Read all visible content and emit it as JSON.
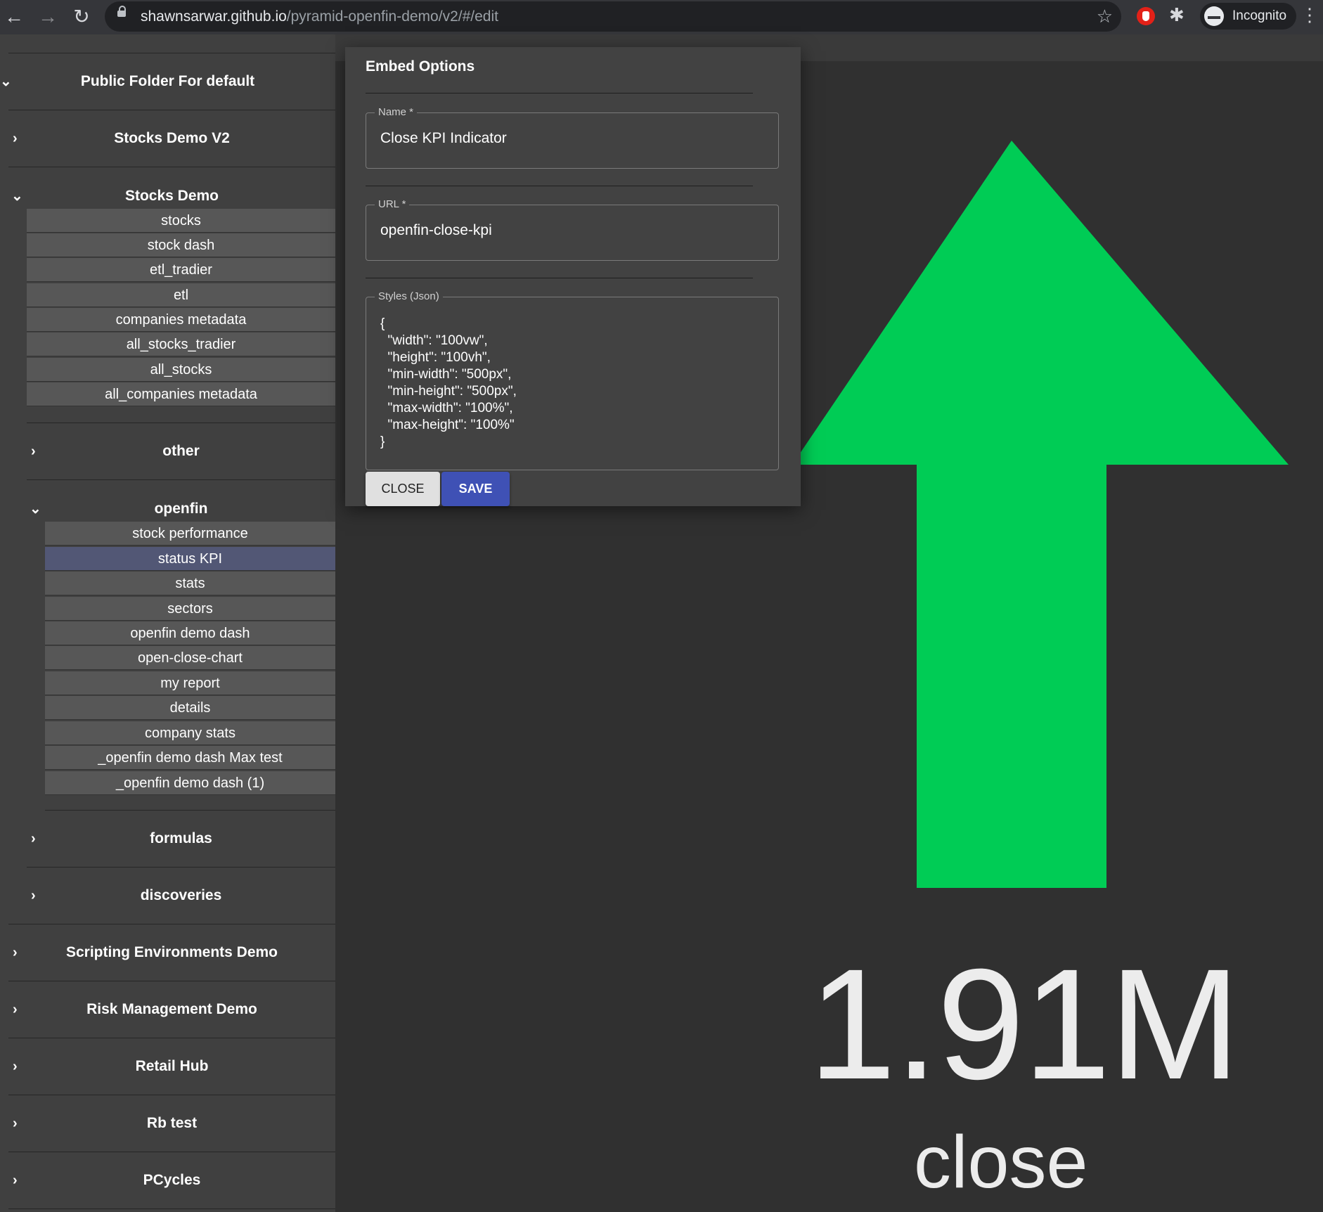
{
  "browser": {
    "url_host": "shawnsarwar.github.io",
    "url_path": "/pyramid-openfin-demo/v2/#/edit",
    "profile_label": "Incognito"
  },
  "sidebar": {
    "public_folder": "Public Folder For default",
    "stocks_demo_v2": "Stocks Demo V2",
    "stocks_demo": {
      "label": "Stocks Demo",
      "items": [
        "stocks",
        "stock dash",
        "etl_tradier",
        "etl",
        "companies metadata",
        "all_stocks_tradier",
        "all_stocks",
        "all_companies metadata"
      ]
    },
    "other": "other",
    "openfin": {
      "label": "openfin",
      "items": [
        "stock performance",
        "status KPI",
        "stats",
        "sectors",
        "openfin demo dash",
        "open-close-chart",
        "my report",
        "details",
        "company stats",
        "_openfin demo dash Max test",
        "_openfin demo dash (1)"
      ],
      "selected": "status KPI"
    },
    "formulas": "formulas",
    "discoveries": "discoveries",
    "bottom_folders": [
      "Scripting Environments Demo",
      "Risk Management Demo",
      "Retail Hub",
      "Rb test",
      "PCycles"
    ]
  },
  "dialog": {
    "title": "Embed Options",
    "name_label": "Name  *",
    "name_value": "Close KPI Indicator",
    "url_label": "URL  *",
    "url_value": "openfin-close-kpi",
    "styles_label": "Styles (Json)",
    "styles_value": "{\n  \"width\": \"100vw\",\n  \"height\": \"100vh\",\n  \"min-width\": \"500px\",\n  \"min-height\": \"500px\",\n  \"max-width\": \"100%\",\n  \"max-height\": \"100%\"\n}",
    "close_label": "CLOSE",
    "save_label": "SAVE"
  },
  "kpi": {
    "value": "1.91M",
    "label": "close",
    "arrow_color": "#00cc55",
    "direction": "up"
  },
  "colors": {
    "accent": "#3f51b5",
    "arrow": "#00cc55"
  }
}
